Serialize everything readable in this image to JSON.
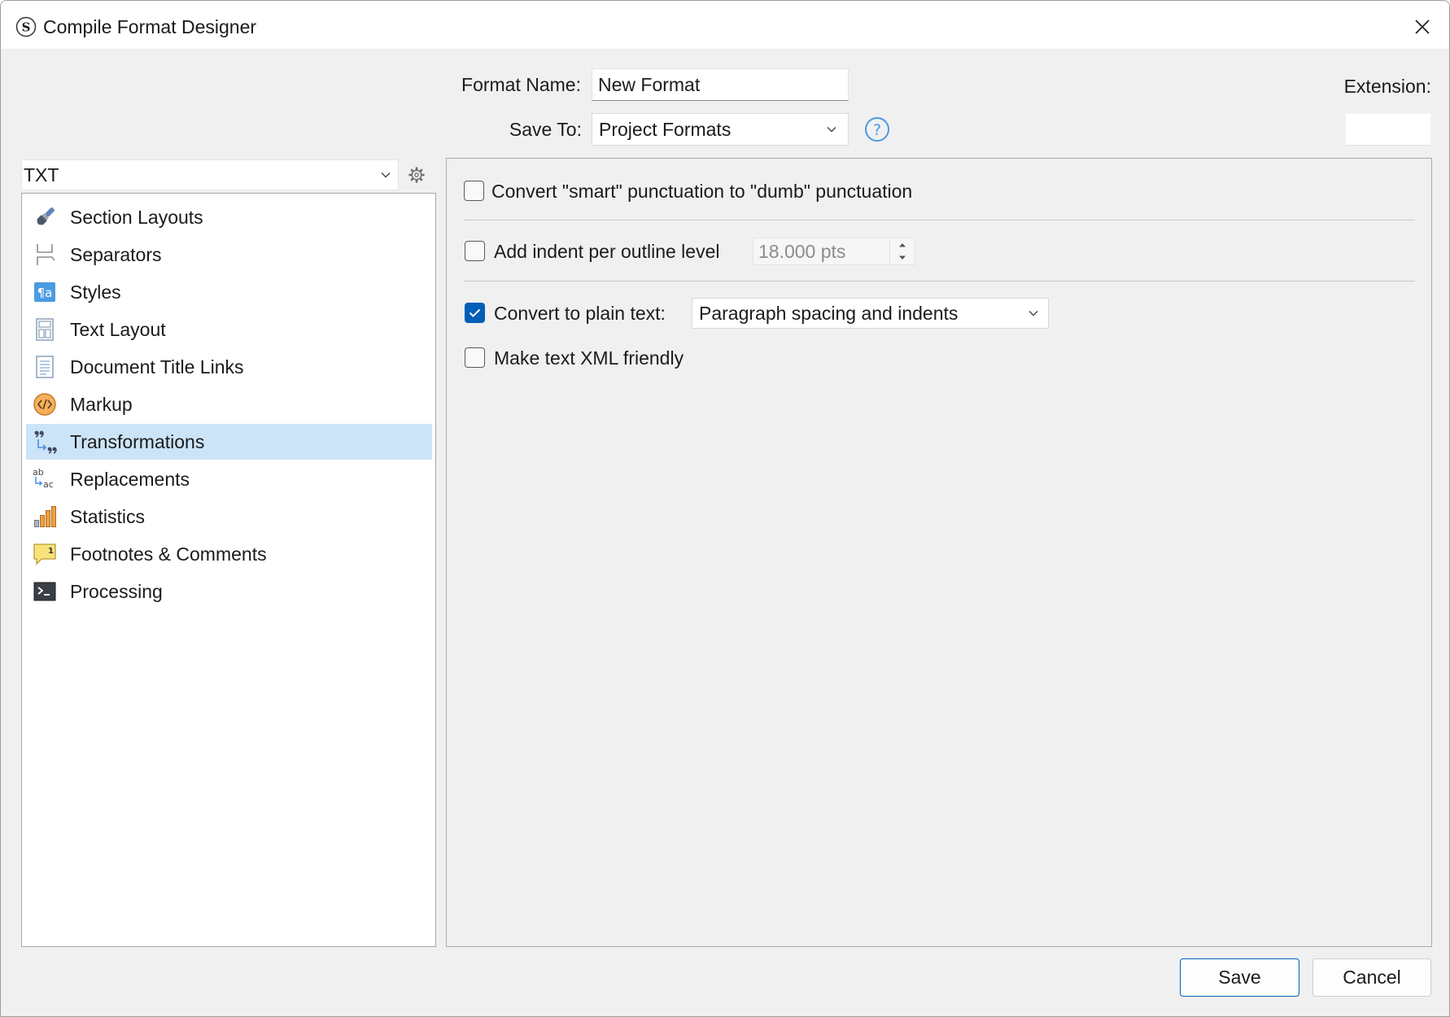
{
  "window": {
    "title": "Compile Format Designer",
    "app_icon": "scrivener-icon",
    "close_icon": "close-icon"
  },
  "header": {
    "format_name_label": "Format Name:",
    "format_name_value": "New Format",
    "save_to_label": "Save To:",
    "save_to_value": "Project Formats",
    "help_icon": "help-icon",
    "extension_label": "Extension:",
    "extension_value": ""
  },
  "sidebar": {
    "format_select_value": "TXT",
    "settings_icon": "gear-icon",
    "selected_index": 6,
    "items": [
      {
        "label": "Section Layouts",
        "icon": "paintbrush-icon"
      },
      {
        "label": "Separators",
        "icon": "separator-icon"
      },
      {
        "label": "Styles",
        "icon": "styles-icon"
      },
      {
        "label": "Text Layout",
        "icon": "text-layout-icon"
      },
      {
        "label": "Document Title Links",
        "icon": "document-icon"
      },
      {
        "label": "Markup",
        "icon": "markup-icon"
      },
      {
        "label": "Transformations",
        "icon": "quotes-transform-icon"
      },
      {
        "label": "Replacements",
        "icon": "replace-icon"
      },
      {
        "label": "Statistics",
        "icon": "bar-chart-icon"
      },
      {
        "label": "Footnotes & Comments",
        "icon": "comment-icon"
      },
      {
        "label": "Processing",
        "icon": "terminal-icon"
      }
    ]
  },
  "options": {
    "smart_punctuation": {
      "label": "Convert \"smart\" punctuation to \"dumb\" punctuation",
      "checked": false
    },
    "outline_indent": {
      "label": "Add indent per outline level",
      "checked": false,
      "value": "18.000 pts",
      "enabled": false
    },
    "plain_text": {
      "label": "Convert to plain text:",
      "checked": true,
      "select_value": "Paragraph spacing and indents"
    },
    "xml_friendly": {
      "label": "Make text XML friendly",
      "checked": false
    }
  },
  "footer": {
    "save_label": "Save",
    "cancel_label": "Cancel"
  },
  "colors": {
    "accent": "#005fb8",
    "selection": "#cce4f7",
    "background": "#f0f0f0"
  }
}
